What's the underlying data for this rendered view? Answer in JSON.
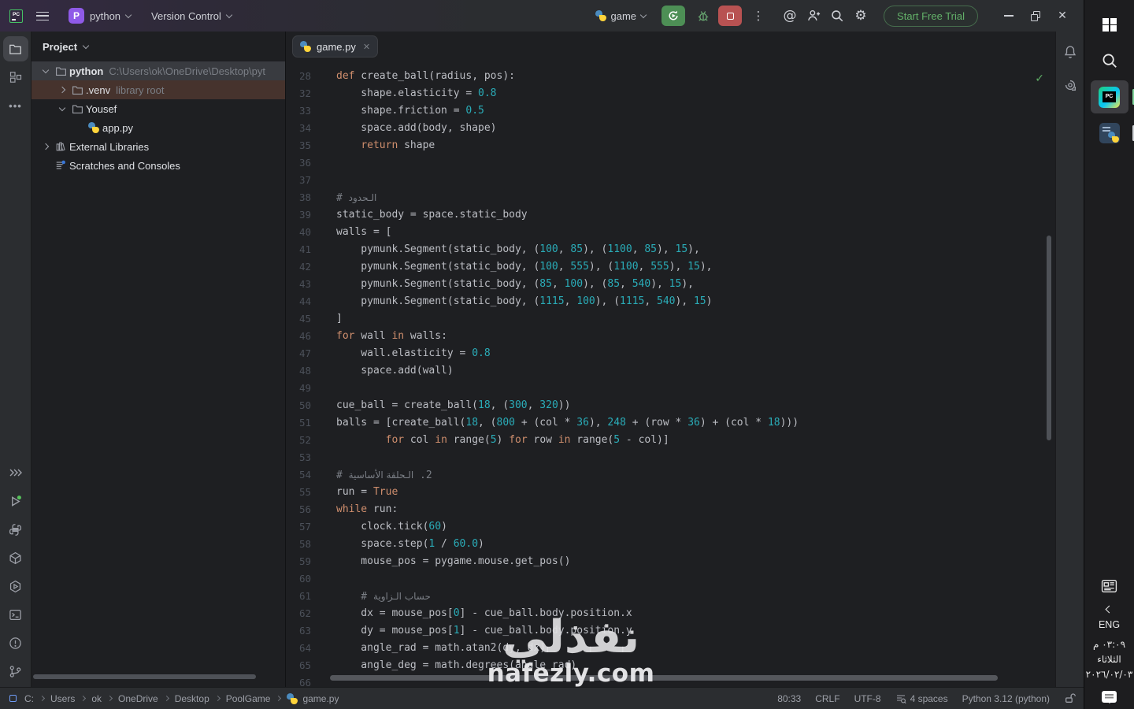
{
  "colors": {
    "keyword": "#cf8e6d",
    "number": "#2aacb8",
    "text": "#bcbec4",
    "comment": "#7a7e85",
    "gutter": "#4b5059",
    "bg_editor": "#1e1f22",
    "bg_chrome": "#2b2d30",
    "selection_row": "#393b40",
    "hover_row": "#46332d",
    "purple_badge": "#8f5ae8",
    "accent_green": "#4d8f55",
    "accent_red": "#b85252",
    "trial_green": "#63b169"
  },
  "titlebar": {
    "app_badge": "PC",
    "project": {
      "initial": "P",
      "name": "python"
    },
    "vcs_label": "Version Control",
    "run_config": "game",
    "trial_label": "Start Free Trial"
  },
  "project_panel": {
    "header_label": "Project",
    "tree": [
      {
        "depth": 0,
        "chevron": "down",
        "icon": "folder",
        "label": "python",
        "bold": true,
        "suffix": "C:\\Users\\ok\\OneDrive\\Desktop\\pyt",
        "state": "selected"
      },
      {
        "depth": 1,
        "chevron": "right",
        "icon": "folder",
        "label": ".venv",
        "bold": false,
        "suffix": "library root",
        "state": "hover"
      },
      {
        "depth": 1,
        "chevron": "down",
        "icon": "folder",
        "label": "Yousef",
        "bold": false,
        "suffix": "",
        "state": ""
      },
      {
        "depth": 2,
        "chevron": "none",
        "icon": "python",
        "label": "app.py",
        "bold": false,
        "suffix": "",
        "state": ""
      },
      {
        "depth": 0,
        "chevron": "right",
        "icon": "library",
        "label": "External Libraries",
        "bold": false,
        "suffix": "",
        "state": ""
      },
      {
        "depth": 0,
        "chevron": "none",
        "icon": "scratch",
        "label": "Scratches and Consoles",
        "bold": false,
        "suffix": "",
        "state": ""
      }
    ]
  },
  "editor": {
    "tab_label": "game.py",
    "code_lines": [
      {
        "n": "28",
        "t": [
          [
            "def",
            "kw"
          ],
          [
            " create_ball(radius, pos):",
            "txt"
          ]
        ]
      },
      {
        "n": "32",
        "t": [
          [
            "    shape.elasticity = ",
            "txt"
          ],
          [
            "0.8",
            "num"
          ]
        ]
      },
      {
        "n": "33",
        "t": [
          [
            "    shape.friction = ",
            "txt"
          ],
          [
            "0.5",
            "num"
          ]
        ]
      },
      {
        "n": "34",
        "t": [
          [
            "    space.add(body, shape)",
            "txt"
          ]
        ]
      },
      {
        "n": "35",
        "t": [
          [
            "    ",
            "txt"
          ],
          [
            "return",
            "kw"
          ],
          [
            " shape",
            "txt"
          ]
        ]
      },
      {
        "n": "36",
        "t": []
      },
      {
        "n": "37",
        "t": []
      },
      {
        "n": "38",
        "t": [
          [
            "# ",
            "com"
          ],
          [
            "الـحدود",
            "com ar"
          ]
        ]
      },
      {
        "n": "39",
        "t": [
          [
            "static_body = space.static_body",
            "txt"
          ]
        ]
      },
      {
        "n": "40",
        "t": [
          [
            "walls = [",
            "txt"
          ]
        ]
      },
      {
        "n": "41",
        "t": [
          [
            "    pymunk.Segment(static_body, (",
            "txt"
          ],
          [
            "100",
            "num"
          ],
          [
            ", ",
            "txt"
          ],
          [
            "85",
            "num"
          ],
          [
            "), (",
            "txt"
          ],
          [
            "1100",
            "num"
          ],
          [
            ", ",
            "txt"
          ],
          [
            "85",
            "num"
          ],
          [
            "), ",
            "txt"
          ],
          [
            "15",
            "num"
          ],
          [
            "),",
            "txt"
          ]
        ]
      },
      {
        "n": "42",
        "t": [
          [
            "    pymunk.Segment(static_body, (",
            "txt"
          ],
          [
            "100",
            "num"
          ],
          [
            ", ",
            "txt"
          ],
          [
            "555",
            "num"
          ],
          [
            "), (",
            "txt"
          ],
          [
            "1100",
            "num"
          ],
          [
            ", ",
            "txt"
          ],
          [
            "555",
            "num"
          ],
          [
            "), ",
            "txt"
          ],
          [
            "15",
            "num"
          ],
          [
            "),",
            "txt"
          ]
        ]
      },
      {
        "n": "43",
        "t": [
          [
            "    pymunk.Segment(static_body, (",
            "txt"
          ],
          [
            "85",
            "num"
          ],
          [
            ", ",
            "txt"
          ],
          [
            "100",
            "num"
          ],
          [
            "), (",
            "txt"
          ],
          [
            "85",
            "num"
          ],
          [
            ", ",
            "txt"
          ],
          [
            "540",
            "num"
          ],
          [
            "), ",
            "txt"
          ],
          [
            "15",
            "num"
          ],
          [
            "),",
            "txt"
          ]
        ]
      },
      {
        "n": "44",
        "t": [
          [
            "    pymunk.Segment(static_body, (",
            "txt"
          ],
          [
            "1115",
            "num"
          ],
          [
            ", ",
            "txt"
          ],
          [
            "100",
            "num"
          ],
          [
            "), (",
            "txt"
          ],
          [
            "1115",
            "num"
          ],
          [
            ", ",
            "txt"
          ],
          [
            "540",
            "num"
          ],
          [
            "), ",
            "txt"
          ],
          [
            "15",
            "num"
          ],
          [
            ")",
            "txt"
          ]
        ]
      },
      {
        "n": "45",
        "t": [
          [
            "]",
            "txt"
          ]
        ]
      },
      {
        "n": "46",
        "t": [
          [
            "for",
            "kw"
          ],
          [
            " wall ",
            "txt"
          ],
          [
            "in",
            "kw"
          ],
          [
            " walls:",
            "txt"
          ]
        ]
      },
      {
        "n": "47",
        "t": [
          [
            "    wall.elasticity = ",
            "txt"
          ],
          [
            "0.8",
            "num"
          ]
        ]
      },
      {
        "n": "48",
        "t": [
          [
            "    space.add(wall)",
            "txt"
          ]
        ]
      },
      {
        "n": "49",
        "t": []
      },
      {
        "n": "50",
        "t": [
          [
            "cue_ball = create_ball(",
            "txt"
          ],
          [
            "18",
            "num"
          ],
          [
            ", (",
            "txt"
          ],
          [
            "300",
            "num"
          ],
          [
            ", ",
            "txt"
          ],
          [
            "320",
            "num"
          ],
          [
            "))",
            "txt"
          ]
        ]
      },
      {
        "n": "51",
        "t": [
          [
            "balls = [create_ball(",
            "txt"
          ],
          [
            "18",
            "num"
          ],
          [
            ", (",
            "txt"
          ],
          [
            "800",
            "num"
          ],
          [
            " + (col * ",
            "txt"
          ],
          [
            "36",
            "num"
          ],
          [
            "), ",
            "txt"
          ],
          [
            "248",
            "num"
          ],
          [
            " + (row * ",
            "txt"
          ],
          [
            "36",
            "num"
          ],
          [
            ") + (col * ",
            "txt"
          ],
          [
            "18",
            "num"
          ],
          [
            ")))",
            "txt"
          ]
        ]
      },
      {
        "n": "52",
        "t": [
          [
            "        ",
            "txt"
          ],
          [
            "for",
            "kw"
          ],
          [
            " col ",
            "txt"
          ],
          [
            "in",
            "kw"
          ],
          [
            " range(",
            "txt"
          ],
          [
            "5",
            "num"
          ],
          [
            ") ",
            "txt"
          ],
          [
            "for",
            "kw"
          ],
          [
            " row ",
            "txt"
          ],
          [
            "in",
            "kw"
          ],
          [
            " range(",
            "txt"
          ],
          [
            "5",
            "num"
          ],
          [
            " - col)]",
            "txt"
          ]
        ]
      },
      {
        "n": "53",
        "t": []
      },
      {
        "n": "54",
        "t": [
          [
            "# ",
            "com"
          ],
          [
            "الـحلقة الأساسية",
            "com ar"
          ],
          [
            " .2",
            "com"
          ]
        ]
      },
      {
        "n": "55",
        "t": [
          [
            "run = ",
            "txt"
          ],
          [
            "True",
            "kw"
          ]
        ]
      },
      {
        "n": "56",
        "t": [
          [
            "while",
            "kw"
          ],
          [
            " run:",
            "txt"
          ]
        ]
      },
      {
        "n": "57",
        "t": [
          [
            "    clock.tick(",
            "txt"
          ],
          [
            "60",
            "num"
          ],
          [
            ")",
            "txt"
          ]
        ]
      },
      {
        "n": "58",
        "t": [
          [
            "    space.step(",
            "txt"
          ],
          [
            "1",
            "num"
          ],
          [
            " / ",
            "txt"
          ],
          [
            "60.0",
            "num"
          ],
          [
            ")",
            "txt"
          ]
        ]
      },
      {
        "n": "59",
        "t": [
          [
            "    mouse_pos = pygame.mouse.get_pos()",
            "txt"
          ]
        ]
      },
      {
        "n": "60",
        "t": []
      },
      {
        "n": "61",
        "t": [
          [
            "    # ",
            "com"
          ],
          [
            "حساب الـزاوية",
            "com ar"
          ]
        ]
      },
      {
        "n": "62",
        "t": [
          [
            "    dx = mouse_pos[",
            "txt"
          ],
          [
            "0",
            "num"
          ],
          [
            "] - cue_ball.body.position.x",
            "txt"
          ]
        ]
      },
      {
        "n": "63",
        "t": [
          [
            "    dy = mouse_pos[",
            "txt"
          ],
          [
            "1",
            "num"
          ],
          [
            "] - cue_ball.body.position.y",
            "txt"
          ]
        ]
      },
      {
        "n": "64",
        "t": [
          [
            "    angle_rad = math.atan2(dy, dx)",
            "txt"
          ]
        ]
      },
      {
        "n": "65",
        "t": [
          [
            "    angle_deg = math.degrees(angle_rad)",
            "txt"
          ]
        ]
      },
      {
        "n": "66",
        "t": []
      }
    ]
  },
  "status_bar": {
    "breadcrumbs": [
      "C:",
      "Users",
      "ok",
      "OneDrive",
      "Desktop",
      "PoolGame"
    ],
    "file_crumb": "game.py",
    "cursor": "80:33",
    "line_ending": "CRLF",
    "encoding": "UTF-8",
    "indent": "4 spaces",
    "interpreter": "Python 3.12 (python)"
  },
  "taskbar": {
    "pycharm_badge": "PC",
    "language": "ENG",
    "time": "٠٣:٠٩ م",
    "day": "الثلاثاء",
    "date": "٢٠٢٦/٠٢/٠٣"
  },
  "watermark": {
    "arabic": "نفذلي",
    "domain": "nafezly.com"
  }
}
